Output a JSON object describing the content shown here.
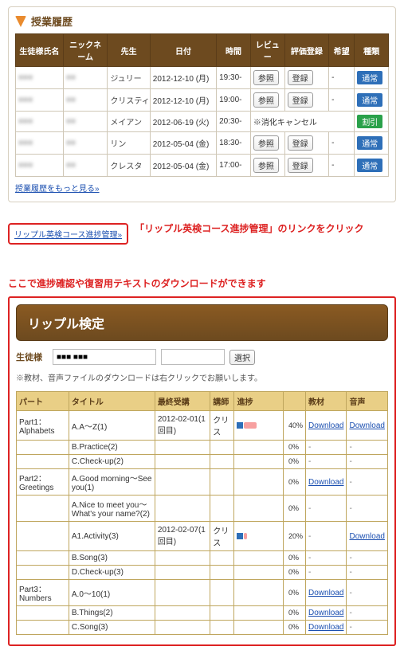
{
  "history": {
    "title": "授業履歴",
    "cols": [
      "生徒様氏名",
      "ニックネーム",
      "先生",
      "日付",
      "時間",
      "レビュー",
      "評価登録",
      "希望",
      "種類"
    ],
    "review_btn": "参照",
    "eval_btn": "登録",
    "rows": [
      {
        "name": "■■■",
        "nick": "■■",
        "teacher": "ジュリー",
        "date": "2012-12-10 (月)",
        "time": "19:30-",
        "wish": "-",
        "kind": "通常",
        "kind_cls": "badge-blue"
      },
      {
        "name": "■■■",
        "nick": "■■",
        "teacher": "クリスティ",
        "date": "2012-12-10 (月)",
        "time": "19:00-",
        "wish": "-",
        "kind": "通常",
        "kind_cls": "badge-blue"
      },
      {
        "name": "■■■",
        "nick": "■■",
        "teacher": "メイアン",
        "date": "2012-06-19 (火)",
        "time": "20:30-",
        "cancel": "※消化キャンセル",
        "kind": "割引",
        "kind_cls": "badge-green"
      },
      {
        "name": "■■■",
        "nick": "■■",
        "teacher": "リン",
        "date": "2012-05-04 (金)",
        "time": "18:30-",
        "wish": "-",
        "kind": "通常",
        "kind_cls": "badge-blue"
      },
      {
        "name": "■■■",
        "nick": "■■",
        "teacher": "クレスタ",
        "date": "2012-05-04 (金)",
        "time": "17:00-",
        "wish": "-",
        "kind": "通常",
        "kind_cls": "badge-blue"
      }
    ],
    "more": "授業履歴をもっと見る»"
  },
  "linkbox": {
    "text": "リップル英検コース進捗管理»"
  },
  "callout1": "「リップル英検コース進捗管理」のリンクをクリック",
  "callout2": "ここで進捗確認や復習用テキストのダウンロードができます",
  "kentei": {
    "title": "リップル検定",
    "student_lbl": "生徒様",
    "student_val": "■■■ ■■■",
    "select_btn": "選択",
    "note": "※教材、音声ファイルのダウンロードは右クリックでお願いします。",
    "cols": [
      "パート",
      "タイトル",
      "最終受講",
      "講師",
      "進捗",
      "",
      "教材",
      "音声"
    ],
    "dl": "Download",
    "rows": [
      {
        "part": "Part1：Alphabets",
        "title": "A.A～Z(1)",
        "last": "2012-02-01(1回目)",
        "tchr": "クリス",
        "pct": 40,
        "blue": 8,
        "mat": true,
        "aud": true
      },
      {
        "part": "",
        "title": "B.Practice(2)",
        "last": "",
        "tchr": "",
        "pct": 0,
        "mat": false,
        "aud": false
      },
      {
        "part": "",
        "title": "C.Check-up(2)",
        "last": "",
        "tchr": "",
        "pct": 0,
        "mat": false,
        "aud": false
      },
      {
        "part": "Part2：Greetings",
        "title": "A.Good morning～See you(1)",
        "last": "",
        "tchr": "",
        "pct": 0,
        "mat": true,
        "aud": false
      },
      {
        "part": "",
        "title": "A.Nice to meet you～What's your name?(2)",
        "last": "",
        "tchr": "",
        "pct": 0,
        "mat": false,
        "aud": false
      },
      {
        "part": "",
        "title": "A1.Activity(3)",
        "last": "2012-02-07(1回目)",
        "tchr": "クリス",
        "pct": 20,
        "blue": 8,
        "mat": false,
        "aud": true
      },
      {
        "part": "",
        "title": "B.Song(3)",
        "last": "",
        "tchr": "",
        "pct": 0,
        "mat": false,
        "aud": false
      },
      {
        "part": "",
        "title": "D.Check-up(3)",
        "last": "",
        "tchr": "",
        "pct": 0,
        "mat": false,
        "aud": false
      },
      {
        "part": "Part3：Numbers",
        "title": "A.0～10(1)",
        "last": "",
        "tchr": "",
        "pct": 0,
        "mat": true,
        "aud": false
      },
      {
        "part": "",
        "title": "B.Things(2)",
        "last": "",
        "tchr": "",
        "pct": 0,
        "mat": true,
        "aud": false
      },
      {
        "part": "",
        "title": "C.Song(3)",
        "last": "",
        "tchr": "",
        "pct": 0,
        "mat": true,
        "aud": false
      }
    ]
  }
}
